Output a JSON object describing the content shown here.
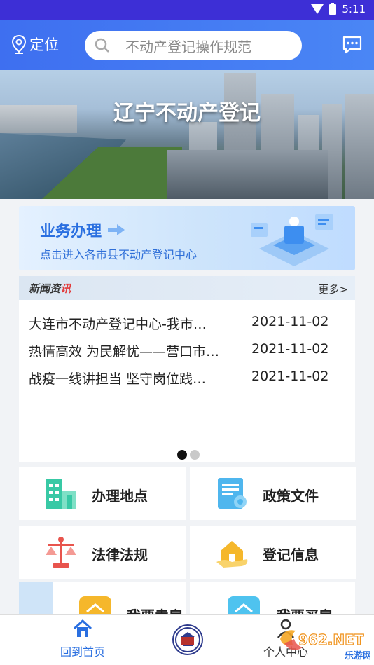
{
  "status_bar": {
    "time": "5:11"
  },
  "header": {
    "location_label": "定位",
    "search_placeholder": "不动产登记操作规范"
  },
  "banner": {
    "title": "辽宁不动产登记"
  },
  "business_card": {
    "title": "业务办理",
    "subtitle": "点击进入各市县不动产登记中心"
  },
  "news": {
    "heading_main": "新闻资",
    "heading_accent": "讯",
    "more_label": "更多>",
    "items": [
      {
        "title": "大连市不动产登记中心-我市…",
        "date": "2021-11-02"
      },
      {
        "title": "热情高效 为民解忧——营口市…",
        "date": "2021-11-02"
      },
      {
        "title": "战疫一线讲担当 坚守岗位践…",
        "date": "2021-11-02"
      }
    ],
    "carousel_active_index": 0
  },
  "tiles": [
    {
      "label": "办理地点",
      "icon": "building-icon"
    },
    {
      "label": "政策文件",
      "icon": "document-certificate-icon"
    },
    {
      "label": "法律法规",
      "icon": "scales-of-justice-icon"
    },
    {
      "label": "登记信息",
      "icon": "house-in-hand-icon"
    }
  ],
  "partial_tiles": [
    {
      "label": "我要卖房",
      "icon": "house-sell-icon"
    },
    {
      "label": "我要买房",
      "icon": "house-buy-icon"
    }
  ],
  "tab_bar": {
    "home_label": "回到首页",
    "profile_label": "个人中心"
  },
  "watermark": {
    "brand": "962.NET",
    "sub": "乐游网"
  },
  "colors": {
    "status_bar": "#3d2fd6",
    "header": "#3e6ff0",
    "accent_blue": "#2a6fe0",
    "tile_icon_green": "#38c9a5",
    "tile_icon_red": "#e8544d",
    "tile_icon_yellow": "#f5b72b"
  }
}
